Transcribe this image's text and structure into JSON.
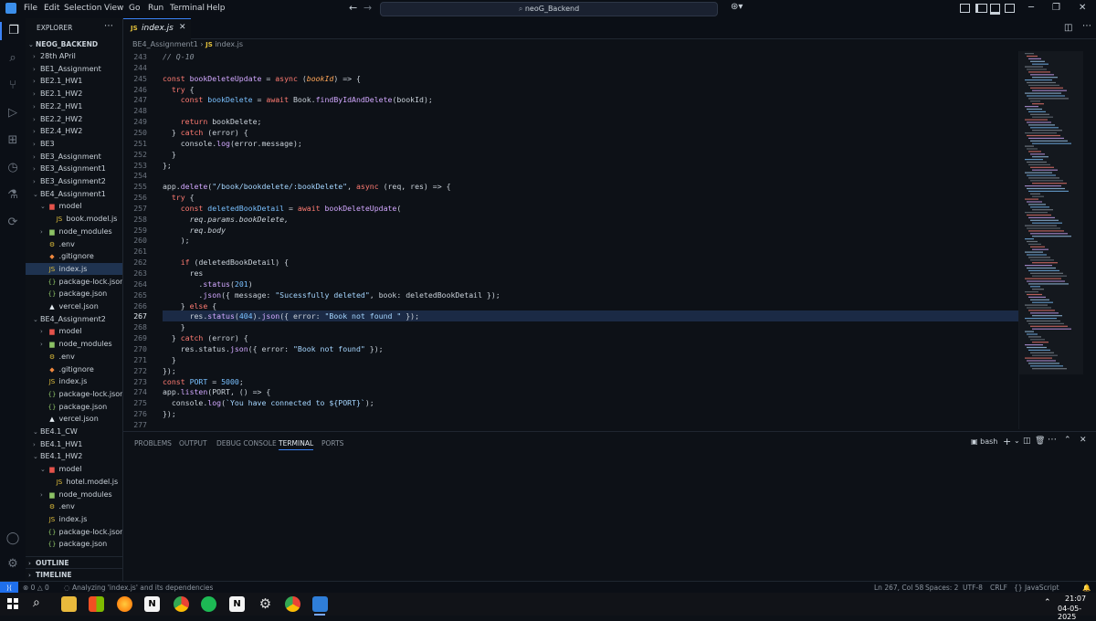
{
  "menu": [
    "File",
    "Edit",
    "Selection",
    "View",
    "Go",
    "Run",
    "Terminal",
    "Help"
  ],
  "search": {
    "text": "neoG_Backend"
  },
  "explorer": {
    "title": "EXPLORER",
    "root": "NEOG_BACKEND",
    "items": [
      {
        "depth": 1,
        "type": "folder",
        "open": false,
        "label": "28th APril"
      },
      {
        "depth": 1,
        "type": "folder",
        "open": false,
        "label": "BE1_Assignment"
      },
      {
        "depth": 1,
        "type": "folder",
        "open": false,
        "label": "BE2.1_HW1"
      },
      {
        "depth": 1,
        "type": "folder",
        "open": false,
        "label": "BE2.1_HW2"
      },
      {
        "depth": 1,
        "type": "folder",
        "open": false,
        "label": "BE2.2_HW1"
      },
      {
        "depth": 1,
        "type": "folder",
        "open": false,
        "label": "BE2.2_HW2"
      },
      {
        "depth": 1,
        "type": "folder",
        "open": false,
        "label": "BE2.4_HW2"
      },
      {
        "depth": 1,
        "type": "folder",
        "open": false,
        "label": "BE3"
      },
      {
        "depth": 1,
        "type": "folder",
        "open": false,
        "label": "BE3_Assignment"
      },
      {
        "depth": 1,
        "type": "folder",
        "open": false,
        "label": "BE3_Assignment1"
      },
      {
        "depth": 1,
        "type": "folder",
        "open": false,
        "label": "BE3_Assignment2"
      },
      {
        "depth": 1,
        "type": "folder",
        "open": true,
        "label": "BE4_Assignment1"
      },
      {
        "depth": 2,
        "type": "model",
        "open": true,
        "label": "model"
      },
      {
        "depth": 3,
        "type": "js",
        "label": "book.model.js"
      },
      {
        "depth": 2,
        "type": "nodemod",
        "open": false,
        "label": "node_modules"
      },
      {
        "depth": 2,
        "type": "env",
        "label": ".env"
      },
      {
        "depth": 2,
        "type": "git",
        "label": ".gitignore"
      },
      {
        "depth": 2,
        "type": "js",
        "label": "index.js",
        "active": true
      },
      {
        "depth": 2,
        "type": "json",
        "label": "package-lock.json"
      },
      {
        "depth": 2,
        "type": "json",
        "label": "package.json"
      },
      {
        "depth": 2,
        "type": "vercel",
        "label": "vercel.json"
      },
      {
        "depth": 1,
        "type": "folder",
        "open": true,
        "label": "BE4_Assignment2"
      },
      {
        "depth": 2,
        "type": "model",
        "open": false,
        "label": "model"
      },
      {
        "depth": 2,
        "type": "nodemod",
        "open": false,
        "label": "node_modules"
      },
      {
        "depth": 2,
        "type": "env",
        "label": ".env"
      },
      {
        "depth": 2,
        "type": "git",
        "label": ".gitignore"
      },
      {
        "depth": 2,
        "type": "js",
        "label": "index.js"
      },
      {
        "depth": 2,
        "type": "json",
        "label": "package-lock.json"
      },
      {
        "depth": 2,
        "type": "json",
        "label": "package.json"
      },
      {
        "depth": 2,
        "type": "vercel",
        "label": "vercel.json"
      },
      {
        "depth": 1,
        "type": "folder",
        "open": true,
        "label": "BE4.1_CW"
      },
      {
        "depth": 1,
        "type": "folder",
        "open": false,
        "label": "BE4.1_HW1"
      },
      {
        "depth": 1,
        "type": "folder",
        "open": true,
        "label": "BE4.1_HW2"
      },
      {
        "depth": 2,
        "type": "model",
        "open": true,
        "label": "model"
      },
      {
        "depth": 3,
        "type": "js",
        "label": "hotel.model.js"
      },
      {
        "depth": 2,
        "type": "nodemod",
        "open": false,
        "label": "node_modules"
      },
      {
        "depth": 2,
        "type": "env",
        "label": ".env"
      },
      {
        "depth": 2,
        "type": "js",
        "label": "index.js"
      },
      {
        "depth": 2,
        "type": "json",
        "label": "package-lock.json"
      },
      {
        "depth": 2,
        "type": "json",
        "label": "package.json"
      }
    ],
    "outline": "OUTLINE",
    "timeline": "TIMELINE"
  },
  "tab": {
    "label": "index.js"
  },
  "breadcrumb": {
    "folder": "BE4_Assignment1",
    "file": "index.js"
  },
  "editor": {
    "highlight_line": 267,
    "lines": [
      {
        "n": 243,
        "t": [
          [
            "cm",
            "// Q-10"
          ]
        ]
      },
      {
        "n": 244,
        "t": []
      },
      {
        "n": 245,
        "t": [
          [
            "kw",
            "const "
          ],
          [
            "fn",
            "bookDeleteUpdate"
          ],
          [
            "vr",
            " = "
          ],
          [
            "kw",
            "async "
          ],
          [
            "vr",
            "("
          ],
          [
            "pr",
            "bookId"
          ],
          [
            "vr",
            ") => {"
          ]
        ]
      },
      {
        "n": 246,
        "t": [
          [
            "kw",
            "  try "
          ],
          [
            "vr",
            "{"
          ]
        ]
      },
      {
        "n": 247,
        "t": [
          [
            "kw",
            "    const "
          ],
          [
            "nm",
            "bookDelete"
          ],
          [
            "vr",
            " = "
          ],
          [
            "kw",
            "await "
          ],
          [
            "vr",
            "Book."
          ],
          [
            "fn",
            "findByIdAndDelete"
          ],
          [
            "vr",
            "(bookId);"
          ]
        ]
      },
      {
        "n": 248,
        "t": []
      },
      {
        "n": 249,
        "t": [
          [
            "kw",
            "    return "
          ],
          [
            "vr",
            "bookDelete;"
          ]
        ]
      },
      {
        "n": 250,
        "t": [
          [
            "vr",
            "  } "
          ],
          [
            "kw",
            "catch "
          ],
          [
            "vr",
            "(error) {"
          ]
        ]
      },
      {
        "n": 251,
        "t": [
          [
            "vr",
            "    console."
          ],
          [
            "fn",
            "log"
          ],
          [
            "vr",
            "(error.message);"
          ]
        ]
      },
      {
        "n": 252,
        "t": [
          [
            "vr",
            "  }"
          ]
        ]
      },
      {
        "n": 253,
        "t": [
          [
            "vr",
            "};"
          ]
        ]
      },
      {
        "n": 254,
        "t": []
      },
      {
        "n": 255,
        "t": [
          [
            "vr",
            "app."
          ],
          [
            "fn",
            "delete"
          ],
          [
            "vr",
            "("
          ],
          [
            "st",
            "\"/book/bookdelete/:bookDelete\""
          ],
          [
            "vr",
            ", "
          ],
          [
            "kw",
            "async "
          ],
          [
            "vr",
            "(req, res) => {"
          ]
        ]
      },
      {
        "n": 256,
        "t": [
          [
            "kw",
            "  try "
          ],
          [
            "vr",
            "{"
          ]
        ]
      },
      {
        "n": 257,
        "t": [
          [
            "kw",
            "    const "
          ],
          [
            "nm",
            "deletedBookDetail"
          ],
          [
            "vr",
            " = "
          ],
          [
            "kw",
            "await "
          ],
          [
            "fn",
            "bookDeleteUpdate"
          ],
          [
            "vr",
            "("
          ]
        ]
      },
      {
        "n": 258,
        "t": [
          [
            "vr",
            "      req.params.bookDelete,"
          ]
        ]
      },
      {
        "n": 259,
        "t": [
          [
            "vr",
            "      req.body"
          ]
        ]
      },
      {
        "n": 260,
        "t": [
          [
            "vr",
            "    );"
          ]
        ]
      },
      {
        "n": 261,
        "t": []
      },
      {
        "n": 262,
        "t": [
          [
            "kw",
            "    if "
          ],
          [
            "vr",
            "(deletedBookDetail) {"
          ]
        ]
      },
      {
        "n": 263,
        "t": [
          [
            "vr",
            "      res"
          ]
        ]
      },
      {
        "n": 264,
        "t": [
          [
            "vr",
            "        ."
          ],
          [
            "fn",
            "status"
          ],
          [
            "vr",
            "("
          ],
          [
            "nm",
            "201"
          ],
          [
            "vr",
            ")"
          ]
        ]
      },
      {
        "n": 265,
        "t": [
          [
            "vr",
            "        ."
          ],
          [
            "fn",
            "json"
          ],
          [
            "vr",
            "({ message: "
          ],
          [
            "st",
            "\"Sucessfully deleted\""
          ],
          [
            "vr",
            ", book: deletedBookDetail });"
          ]
        ]
      },
      {
        "n": 266,
        "t": [
          [
            "vr",
            "    } "
          ],
          [
            "kw",
            "else "
          ],
          [
            "vr",
            "{"
          ]
        ]
      },
      {
        "n": 267,
        "t": [
          [
            "vr",
            "      res."
          ],
          [
            "fn",
            "status"
          ],
          [
            "vr",
            "("
          ],
          [
            "nm",
            "404"
          ],
          [
            "vr",
            ")."
          ],
          [
            "fn",
            "json"
          ],
          [
            "vr",
            "({ error: "
          ],
          [
            "st",
            "\"Book not found \""
          ],
          [
            "vr",
            " });"
          ]
        ]
      },
      {
        "n": 268,
        "t": [
          [
            "vr",
            "    }"
          ]
        ]
      },
      {
        "n": 269,
        "t": [
          [
            "vr",
            "  } "
          ],
          [
            "kw",
            "catch "
          ],
          [
            "vr",
            "(error) {"
          ]
        ]
      },
      {
        "n": 270,
        "t": [
          [
            "vr",
            "    res.status."
          ],
          [
            "fn",
            "json"
          ],
          [
            "vr",
            "({ error: "
          ],
          [
            "st",
            "\"Book not found\""
          ],
          [
            "vr",
            " });"
          ]
        ]
      },
      {
        "n": 271,
        "t": [
          [
            "vr",
            "  }"
          ]
        ]
      },
      {
        "n": 272,
        "t": [
          [
            "vr",
            "});"
          ]
        ]
      },
      {
        "n": 273,
        "t": [
          [
            "kw",
            "const "
          ],
          [
            "nm",
            "PORT"
          ],
          [
            "vr",
            " = "
          ],
          [
            "nm",
            "5000"
          ],
          [
            "vr",
            ";"
          ]
        ]
      },
      {
        "n": 274,
        "t": [
          [
            "vr",
            "app."
          ],
          [
            "fn",
            "listen"
          ],
          [
            "vr",
            "(PORT, () => {"
          ]
        ]
      },
      {
        "n": 275,
        "t": [
          [
            "vr",
            "  console."
          ],
          [
            "fn",
            "log"
          ],
          [
            "vr",
            "("
          ],
          [
            "st",
            "`You have connected to ${PORT}`"
          ],
          [
            "vr",
            ");"
          ]
        ]
      },
      {
        "n": 276,
        "t": [
          [
            "vr",
            "});"
          ]
        ]
      },
      {
        "n": 277,
        "t": []
      }
    ]
  },
  "panel": {
    "tabs": [
      "PROBLEMS",
      "OUTPUT",
      "DEBUG CONSOLE",
      "TERMINAL",
      "PORTS"
    ],
    "active_tab": "TERMINAL",
    "shell": "bash"
  },
  "status": {
    "errors": "0",
    "warnings": "0",
    "analyzing": "Analyzing 'index.js' and its dependencies",
    "position": "Ln 267, Col 58",
    "spaces": "Spaces: 2",
    "encoding": "UTF-8",
    "eol": "CRLF",
    "language": "JavaScript"
  },
  "taskbar": {
    "time": "21:07",
    "date": "04-05-2025"
  }
}
